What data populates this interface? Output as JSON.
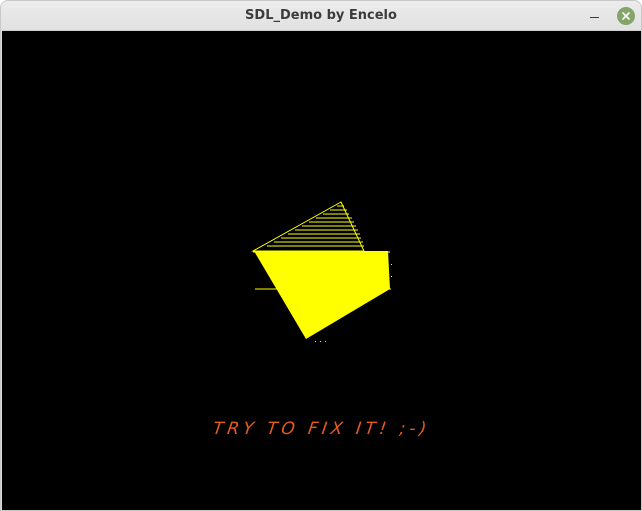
{
  "window": {
    "title": "SDL_Demo by Encelo",
    "controls": {
      "minimize_icon": "minimize-icon",
      "close_icon": "close-icon",
      "close_color": "#83a56a"
    }
  },
  "canvas": {
    "background": "#000000",
    "shape_color": "#ffff00",
    "caption": "TRY TO FIX IT! ;-)",
    "caption_color": "#e85a1a"
  }
}
